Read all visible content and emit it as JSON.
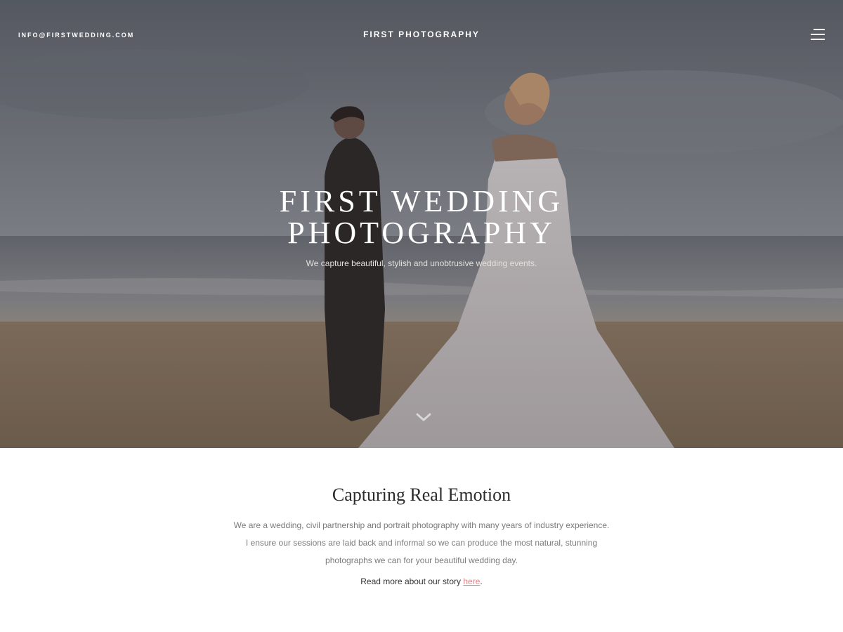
{
  "header": {
    "email": "INFO@FIRSTWEDDING.COM",
    "brand": "FIRST PHOTOGRAPHY",
    "menu_icon": "hamburger-menu-icon"
  },
  "hero": {
    "title_line1": "FIRST WEDDING",
    "title_line2": "PHOTOGRAPHY",
    "subtitle": "We capture beautiful, stylish and unobtrusive wedding events.",
    "scroll_icon": "chevron-down-icon"
  },
  "about": {
    "title": "Capturing Real Emotion",
    "body_line1": "We are a wedding, civil partnership and portrait photography with many years of industry experience.",
    "body_line2": "I ensure our sessions are laid back and informal so we can produce the most natural, stunning",
    "body_line3": "photographs we can for your beautiful wedding day.",
    "read_more_text": "Read more about our story",
    "read_more_link": "here",
    "read_more_end": ".",
    "link_color": "#d9868a"
  }
}
